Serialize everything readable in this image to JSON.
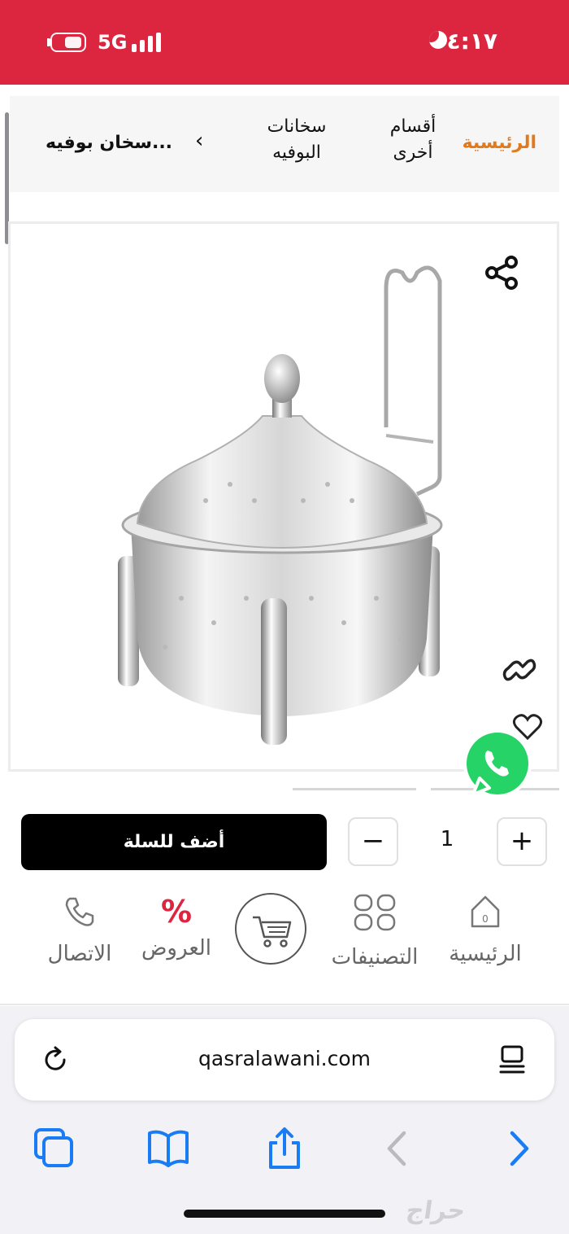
{
  "status_bar": {
    "time": "٤:١٧",
    "network": "5G",
    "battery_level": 0.55,
    "signal_bars": 4
  },
  "breadcrumb": {
    "home": "الرئيسية",
    "other_sections": "أقسام\nأخرى",
    "category": "سخانات\nالبوفيه",
    "current": "سخان بوفيه..."
  },
  "product": {
    "image_icon": "buffet-warmer-pot-photo",
    "actions": [
      "share-icon",
      "link-icon",
      "heart-icon"
    ]
  },
  "cart": {
    "quantity": "1",
    "minus_label": "−",
    "plus_label": "+",
    "add_to_cart_label": "أضف للسلة"
  },
  "bottom_nav": {
    "home": "الرئيسية",
    "home_badge": "0",
    "categories": "التصنيفات",
    "offers": "العروض",
    "offers_icon_text": "%",
    "contact": "الاتصال"
  },
  "browser": {
    "url": "qasralawani.com"
  },
  "watermark": "حراج",
  "colors": {
    "brand_red": "#dc2640",
    "breadcrumb_accent": "#e07a1f",
    "whatsapp_green": "#25d366",
    "safari_blue": "#1a7cf5"
  }
}
